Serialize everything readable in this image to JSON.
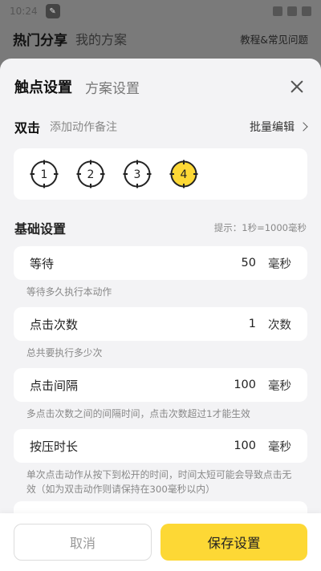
{
  "status_bar": {
    "time": "10:24"
  },
  "background_nav": {
    "tab_active": "热门分享",
    "tab_other": "我的方案",
    "help_link": "教程&常见问题"
  },
  "sheet": {
    "tab_active": "触点设置",
    "tab_other": "方案设置"
  },
  "action": {
    "title": "双击",
    "note_placeholder": "添加动作备注",
    "batch_edit": "批量编辑"
  },
  "points": [
    {
      "label": "1",
      "active": false
    },
    {
      "label": "2",
      "active": false
    },
    {
      "label": "3",
      "active": false
    },
    {
      "label": "4",
      "active": true
    }
  ],
  "basic": {
    "title": "基础设置",
    "hint": "提示：1秒=1000毫秒"
  },
  "fields": [
    {
      "label": "等待",
      "value": "50",
      "unit": "毫秒",
      "desc": "等待多久执行本动作"
    },
    {
      "label": "点击次数",
      "value": "1",
      "unit": "次数",
      "desc": "总共要执行多少次"
    },
    {
      "label": "点击间隔",
      "value": "100",
      "unit": "毫秒",
      "desc": "多点击次数之间的间隔时间，点击次数超过1才能生效"
    },
    {
      "label": "按压时长",
      "value": "100",
      "unit": "毫秒",
      "desc": "单次点击动作从按下到松开的时间，时间太短可能会导致点击无效（如为双击动作则请保持在300毫秒以内）"
    }
  ],
  "footer": {
    "cancel": "取消",
    "save": "保存设置"
  },
  "colors": {
    "accent": "#fdd835",
    "sheet_bg": "#f3f3f5"
  }
}
